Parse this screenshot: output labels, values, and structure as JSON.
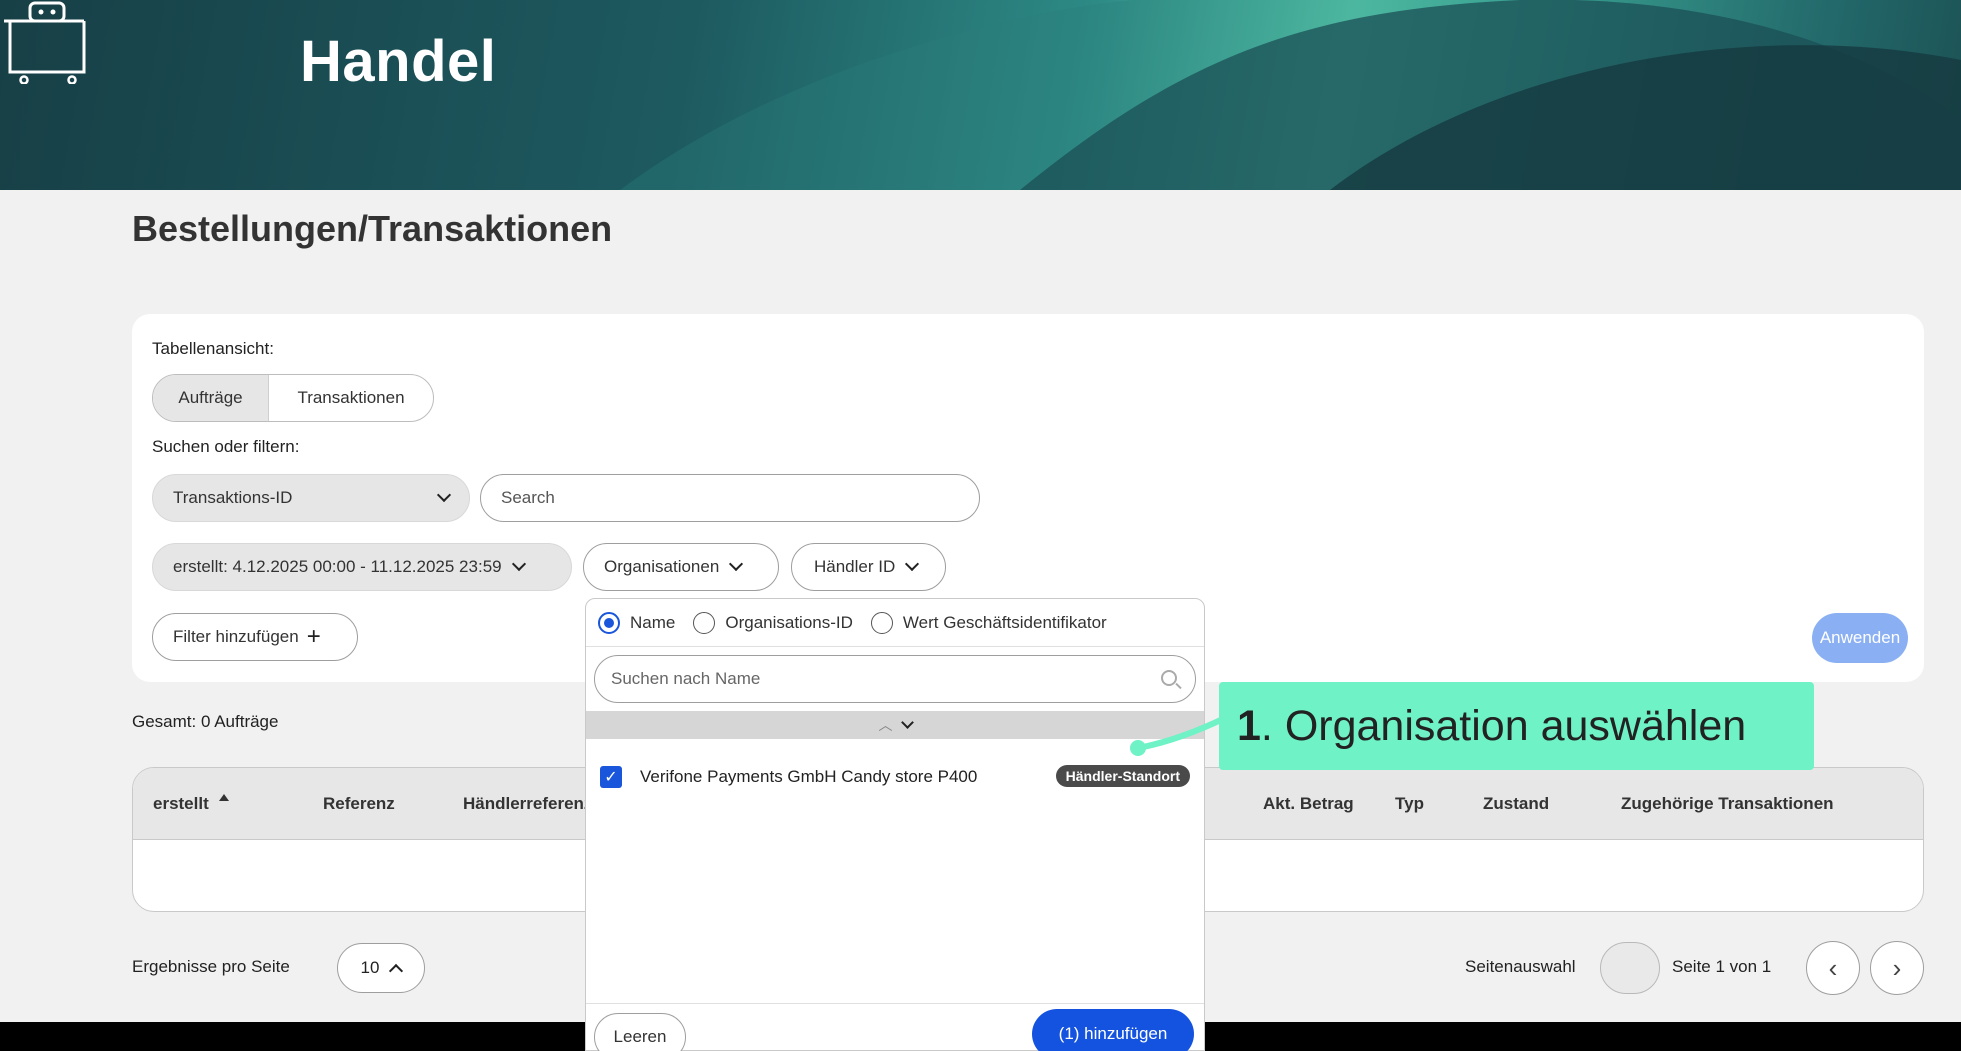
{
  "header": {
    "app_title": "Handel"
  },
  "page": {
    "title": "Bestellungen/Transaktionen"
  },
  "filters": {
    "table_view_label": "Tabellenansicht:",
    "view_options": [
      "Aufträge",
      "Transaktionen"
    ],
    "search_label": "Suchen oder filtern:",
    "field_select": "Transaktions-ID",
    "search_placeholder": "Search",
    "date_filter": "erstellt: 4.12.2025 00:00 - 11.12.2025 23:59",
    "org_filter": "Organisationen",
    "merchant_filter": "Händler ID",
    "add_filter": "Filter hinzufügen",
    "apply": "Anwenden"
  },
  "total": "Gesamt: 0 Aufträge",
  "table": {
    "columns": [
      "erstellt",
      "Referenz",
      "Händlerreferenz",
      "Akt. Betrag",
      "Typ",
      "Zustand",
      "Zugehörige Transaktionen"
    ]
  },
  "pagination": {
    "per_page_label": "Ergebnisse pro Seite",
    "per_page": "10",
    "page_select_label": "Seitenauswahl",
    "page_of": "Seite 1 von 1"
  },
  "dropdown": {
    "radio_options": [
      "Name",
      "Organisations-ID",
      "Wert Geschäftsidentifikator"
    ],
    "selected_radio": "Name",
    "search_placeholder": "Suchen nach Name",
    "items": [
      {
        "label": "Verifone Payments GmbH Candy store P400",
        "badge": "Händler-Standort",
        "checked": true
      }
    ],
    "clear": "Leeren",
    "add": "(1) hinzufügen"
  },
  "annotation": {
    "number": "1",
    "text": ". Organisation auswählen"
  },
  "colors": {
    "primary": "#1453e0",
    "apply_disabled": "#8ab0f3",
    "callout": "#6ef2c6",
    "banner_dark": "#173f46",
    "banner_light": "#5fd6b4"
  }
}
